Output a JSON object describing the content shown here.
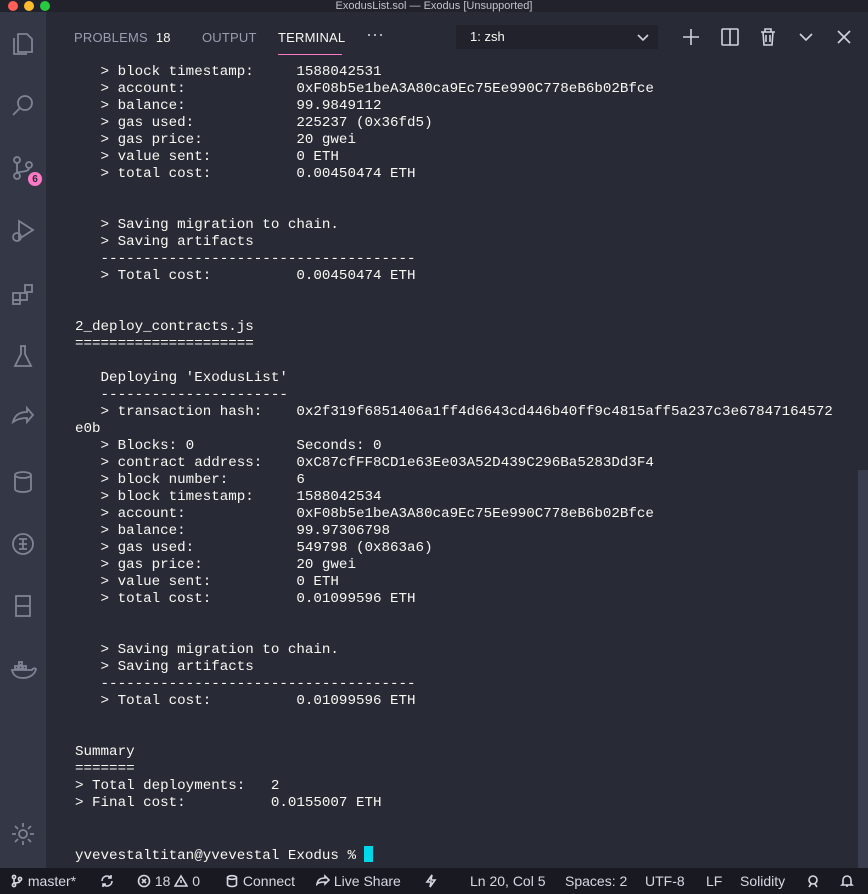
{
  "window": {
    "title": "ExodusList.sol — Exodus [Unsupported]"
  },
  "activity_bar": {
    "scm_badge": "6"
  },
  "panel": {
    "tabs": [
      {
        "label": "PROBLEMS",
        "count": "18"
      },
      {
        "label": "OUTPUT"
      },
      {
        "label": "TERMINAL"
      }
    ],
    "more": "···",
    "terminal_select": "1: zsh"
  },
  "terminal": {
    "lines": [
      "   > block timestamp:     1588042531",
      "   > account:             0xF08b5e1beA3A80ca9Ec75Ee990C778eB6b02Bfce",
      "   > balance:             99.9849112",
      "   > gas used:            225237 (0x36fd5)",
      "   > gas price:           20 gwei",
      "   > value sent:          0 ETH",
      "   > total cost:          0.00450474 ETH",
      "",
      "",
      "   > Saving migration to chain.",
      "   > Saving artifacts",
      "   -------------------------------------",
      "   > Total cost:          0.00450474 ETH",
      "",
      "",
      "2_deploy_contracts.js",
      "=====================",
      "",
      "   Deploying 'ExodusList'",
      "   ----------------------",
      "   > transaction hash:    0x2f319f6851406a1ff4d6643cd446b40ff9c4815aff5a237c3e67847164572",
      "e0b",
      "   > Blocks: 0            Seconds: 0",
      "   > contract address:    0xC87cfFF8CD1e63Ee03A52D439C296Ba5283Dd3F4",
      "   > block number:        6",
      "   > block timestamp:     1588042534",
      "   > account:             0xF08b5e1beA3A80ca9Ec75Ee990C778eB6b02Bfce",
      "   > balance:             99.97306798",
      "   > gas used:            549798 (0x863a6)",
      "   > gas price:           20 gwei",
      "   > value sent:          0 ETH",
      "   > total cost:          0.01099596 ETH",
      "",
      "",
      "   > Saving migration to chain.",
      "   > Saving artifacts",
      "   -------------------------------------",
      "   > Total cost:          0.01099596 ETH",
      "",
      "",
      "Summary",
      "=======",
      "> Total deployments:   2",
      "> Final cost:          0.0155007 ETH",
      "",
      ""
    ],
    "prompt": "yvevestaltitan@yvevestal Exodus % "
  },
  "status_bar": {
    "branch": "master*",
    "errors": "18",
    "warnings": "0",
    "connect": "Connect",
    "live_share": "Live Share",
    "position": "Ln 20, Col 5",
    "spaces": "Spaces: 2",
    "encoding": "UTF-8",
    "eol": "LF",
    "language": "Solidity"
  }
}
